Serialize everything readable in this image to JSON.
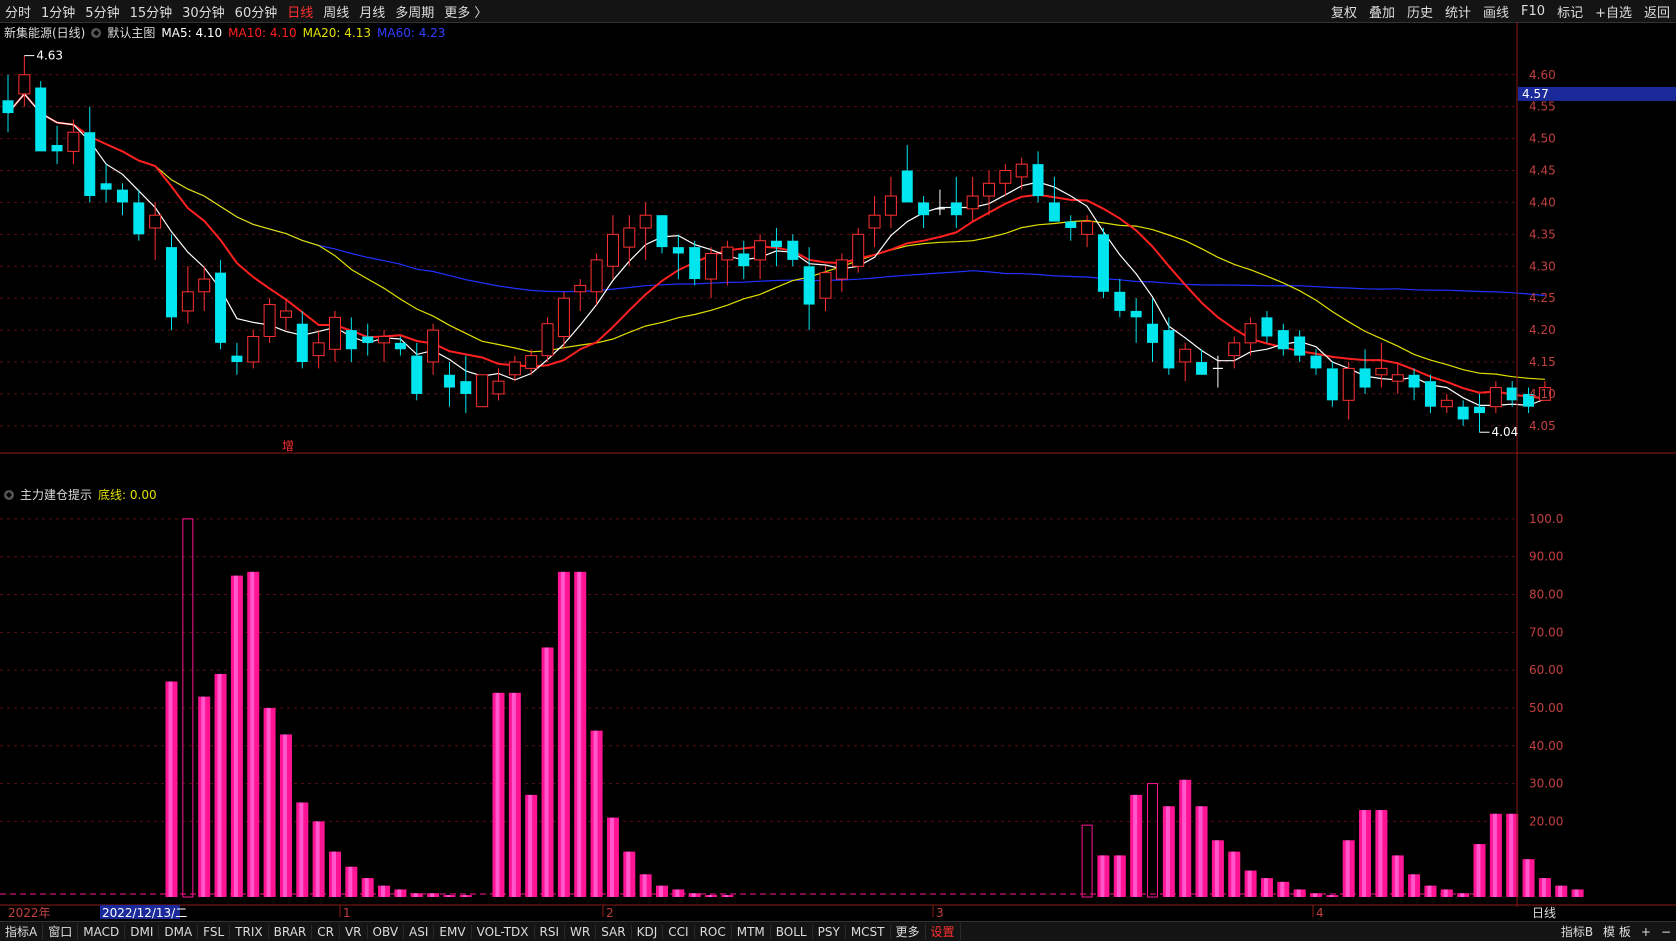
{
  "toolbar": {
    "periods": [
      "分时",
      "1分钟",
      "5分钟",
      "15分钟",
      "30分钟",
      "60分钟",
      "日线",
      "周线",
      "月线",
      "多周期",
      "更多 〉"
    ],
    "active_period": "日线",
    "right_items": [
      "复权",
      "叠加",
      "历史",
      "统计",
      "画线",
      "F10",
      "标记",
      "+自选",
      "返回"
    ]
  },
  "price_legend": {
    "stock": "新集能源(日线)",
    "template": "默认主图",
    "ma5": "MA5: 4.10",
    "ma10": "MA10: 4.10",
    "ma20": "MA20: 4.13",
    "ma60": "MA60: 4.23",
    "colors": {
      "ma5": "#ffffff",
      "ma10": "#ff2020",
      "ma20": "#e0e000",
      "ma60": "#2030ff"
    }
  },
  "indicator_legend": {
    "name": "主力建仓提示",
    "baseline": "底线: 0.00"
  },
  "annotations": {
    "high": "4.63",
    "low": "4.04",
    "increase_marker": "增",
    "current_price": "4.57"
  },
  "x_axis": {
    "year_label": "2022年",
    "cursor_date": "2022/12/13/二",
    "months": [
      "1",
      "2",
      "3",
      "4"
    ],
    "period_label": "日线"
  },
  "chart_data": [
    {
      "type": "candlestick",
      "title": "新集能源(日线)",
      "ylim": [
        4.02,
        4.62
      ],
      "y_ticks": [
        "4.60",
        "4.55",
        "4.50",
        "4.45",
        "4.40",
        "4.35",
        "4.30",
        "4.25",
        "4.20",
        "4.15",
        "4.10",
        "4.05"
      ],
      "ohlc": [
        [
          4.56,
          4.6,
          4.51,
          4.54
        ],
        [
          4.57,
          4.63,
          4.55,
          4.6
        ],
        [
          4.58,
          4.59,
          4.5,
          4.48
        ],
        [
          4.49,
          4.52,
          4.46,
          4.48
        ],
        [
          4.48,
          4.53,
          4.46,
          4.51
        ],
        [
          4.51,
          4.55,
          4.4,
          4.41
        ],
        [
          4.43,
          4.46,
          4.4,
          4.42
        ],
        [
          4.42,
          4.43,
          4.38,
          4.4
        ],
        [
          4.4,
          4.42,
          4.34,
          4.35
        ],
        [
          4.36,
          4.4,
          4.31,
          4.38
        ],
        [
          4.33,
          4.35,
          4.2,
          4.22
        ],
        [
          4.23,
          4.3,
          4.21,
          4.26
        ],
        [
          4.26,
          4.3,
          4.23,
          4.28
        ],
        [
          4.29,
          4.31,
          4.17,
          4.18
        ],
        [
          4.16,
          4.18,
          4.13,
          4.15
        ],
        [
          4.15,
          4.2,
          4.14,
          4.19
        ],
        [
          4.19,
          4.25,
          4.18,
          4.24
        ],
        [
          4.22,
          4.25,
          4.2,
          4.23
        ],
        [
          4.21,
          4.23,
          4.14,
          4.15
        ],
        [
          4.16,
          4.2,
          4.14,
          4.18
        ],
        [
          4.17,
          4.23,
          4.15,
          4.22
        ],
        [
          4.2,
          4.22,
          4.15,
          4.17
        ],
        [
          4.19,
          4.21,
          4.16,
          4.18
        ],
        [
          4.18,
          4.2,
          4.15,
          4.19
        ],
        [
          4.18,
          4.19,
          4.16,
          4.17
        ],
        [
          4.16,
          4.18,
          4.09,
          4.1
        ],
        [
          4.15,
          4.21,
          4.13,
          4.2
        ],
        [
          4.13,
          4.15,
          4.08,
          4.11
        ],
        [
          4.12,
          4.16,
          4.07,
          4.1
        ],
        [
          4.08,
          4.13,
          4.08,
          4.13
        ],
        [
          4.1,
          4.14,
          4.09,
          4.12
        ],
        [
          4.13,
          4.16,
          4.12,
          4.15
        ],
        [
          4.14,
          4.17,
          4.13,
          4.16
        ],
        [
          4.16,
          4.22,
          4.15,
          4.21
        ],
        [
          4.19,
          4.26,
          4.17,
          4.25
        ],
        [
          4.26,
          4.28,
          4.23,
          4.27
        ],
        [
          4.26,
          4.32,
          4.24,
          4.31
        ],
        [
          4.3,
          4.38,
          4.28,
          4.35
        ],
        [
          4.33,
          4.38,
          4.3,
          4.36
        ],
        [
          4.36,
          4.4,
          4.31,
          4.38
        ],
        [
          4.38,
          4.38,
          4.32,
          4.33
        ],
        [
          4.33,
          4.35,
          4.28,
          4.32
        ],
        [
          4.33,
          4.34,
          4.27,
          4.28
        ],
        [
          4.28,
          4.33,
          4.25,
          4.32
        ],
        [
          4.31,
          4.34,
          4.27,
          4.33
        ],
        [
          4.32,
          4.34,
          4.28,
          4.3
        ],
        [
          4.31,
          4.35,
          4.28,
          4.34
        ],
        [
          4.34,
          4.36,
          4.3,
          4.33
        ],
        [
          4.34,
          4.35,
          4.3,
          4.31
        ],
        [
          4.3,
          4.33,
          4.2,
          4.24
        ],
        [
          4.25,
          4.3,
          4.23,
          4.29
        ],
        [
          4.28,
          4.32,
          4.26,
          4.31
        ],
        [
          4.3,
          4.36,
          4.29,
          4.35
        ],
        [
          4.36,
          4.41,
          4.33,
          4.38
        ],
        [
          4.38,
          4.44,
          4.36,
          4.41
        ],
        [
          4.45,
          4.49,
          4.4,
          4.4
        ],
        [
          4.4,
          4.41,
          4.36,
          4.38
        ],
        [
          4.39,
          4.42,
          4.38,
          4.39
        ],
        [
          4.4,
          4.44,
          4.36,
          4.38
        ],
        [
          4.39,
          4.44,
          4.37,
          4.41
        ],
        [
          4.41,
          4.45,
          4.38,
          4.43
        ],
        [
          4.43,
          4.46,
          4.41,
          4.45
        ],
        [
          4.44,
          4.47,
          4.42,
          4.46
        ],
        [
          4.46,
          4.48,
          4.4,
          4.41
        ],
        [
          4.4,
          4.44,
          4.37,
          4.37
        ],
        [
          4.37,
          4.38,
          4.34,
          4.36
        ],
        [
          4.35,
          4.38,
          4.33,
          4.37
        ],
        [
          4.35,
          4.36,
          4.25,
          4.26
        ],
        [
          4.26,
          4.28,
          4.22,
          4.23
        ],
        [
          4.23,
          4.25,
          4.18,
          4.22
        ],
        [
          4.21,
          4.25,
          4.15,
          4.18
        ],
        [
          4.2,
          4.22,
          4.13,
          4.14
        ],
        [
          4.15,
          4.18,
          4.12,
          4.17
        ],
        [
          4.15,
          4.17,
          4.13,
          4.13
        ],
        [
          4.14,
          4.16,
          4.11,
          4.14
        ],
        [
          4.16,
          4.19,
          4.14,
          4.18
        ],
        [
          4.18,
          4.22,
          4.16,
          4.21
        ],
        [
          4.22,
          4.23,
          4.18,
          4.19
        ],
        [
          4.2,
          4.21,
          4.16,
          4.17
        ],
        [
          4.19,
          4.2,
          4.15,
          4.16
        ],
        [
          4.16,
          4.17,
          4.13,
          4.14
        ],
        [
          4.14,
          4.15,
          4.08,
          4.09
        ],
        [
          4.09,
          4.15,
          4.06,
          4.14
        ],
        [
          4.14,
          4.17,
          4.1,
          4.11
        ],
        [
          4.13,
          4.18,
          4.11,
          4.14
        ],
        [
          4.12,
          4.15,
          4.1,
          4.13
        ],
        [
          4.13,
          4.14,
          4.09,
          4.11
        ],
        [
          4.12,
          4.13,
          4.07,
          4.08
        ],
        [
          4.08,
          4.1,
          4.07,
          4.09
        ],
        [
          4.08,
          4.09,
          4.05,
          4.06
        ],
        [
          4.08,
          4.1,
          4.04,
          4.07
        ],
        [
          4.08,
          4.12,
          4.07,
          4.11
        ],
        [
          4.11,
          4.12,
          4.08,
          4.09
        ],
        [
          4.1,
          4.11,
          4.07,
          4.08
        ],
        [
          4.09,
          4.12,
          4.09,
          4.11
        ]
      ]
    },
    {
      "type": "bar",
      "title": "主力建仓提示",
      "ylim": [
        0,
        105
      ],
      "y_ticks": [
        "100.0",
        "90.00",
        "80.00",
        "70.00",
        "60.00",
        "50.00",
        "40.00",
        "30.00",
        "20.00"
      ],
      "values": [
        0,
        0,
        0,
        0,
        0,
        0,
        0,
        0,
        0,
        0,
        57,
        100,
        53,
        59,
        85,
        86,
        50,
        43,
        25,
        20,
        12,
        8,
        5,
        3,
        2,
        1,
        1,
        0.5,
        0.5,
        0,
        54,
        54,
        27,
        66,
        86,
        86,
        44,
        21,
        12,
        6,
        3,
        2,
        1,
        0.5,
        0.5,
        0,
        0,
        0,
        0,
        0,
        0,
        0,
        0,
        0,
        0,
        0,
        0,
        0,
        0,
        0,
        0,
        0,
        0,
        0,
        0,
        0,
        19,
        11,
        11,
        27,
        30,
        24,
        31,
        24,
        15,
        12,
        7,
        5,
        4,
        2,
        1,
        0.5,
        15,
        23,
        23,
        11,
        6,
        3,
        2,
        1,
        14,
        22,
        22,
        10,
        5,
        3,
        2
      ]
    }
  ]
}
